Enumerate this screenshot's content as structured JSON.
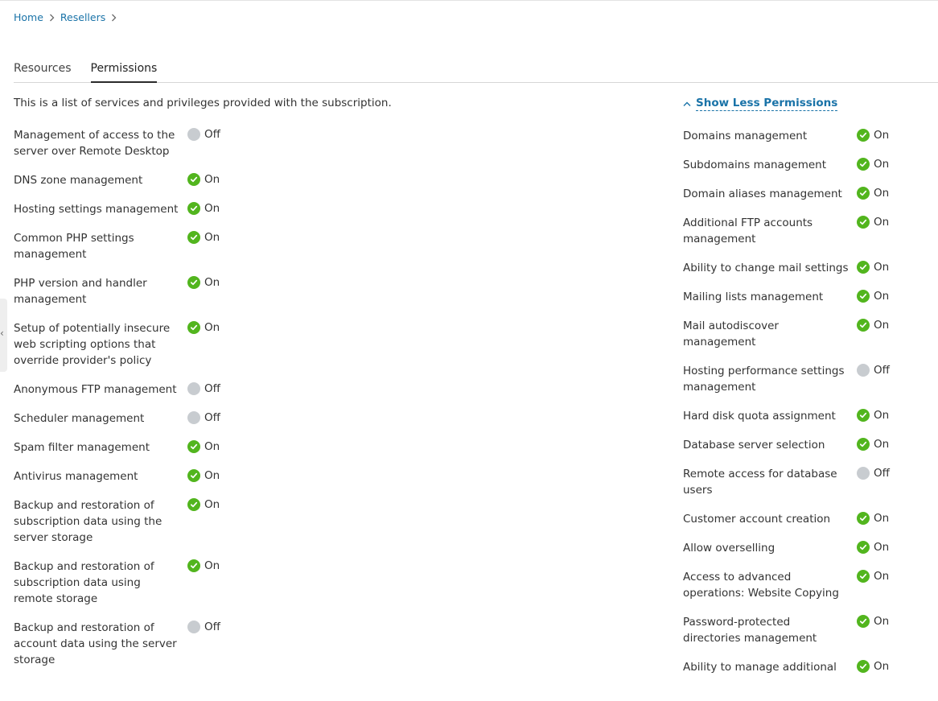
{
  "breadcrumb": {
    "home": "Home",
    "resellers": "Resellers"
  },
  "tabs": [
    {
      "label": "Resources",
      "active": false
    },
    {
      "label": "Permissions",
      "active": true
    }
  ],
  "intro": "This is a list of services and privileges provided with the subscription.",
  "show_less_label": "Show Less Permissions",
  "status_labels": {
    "on": "On",
    "off": "Off"
  },
  "colors": {
    "link": "#1a73a8",
    "on": "#52b51e",
    "off": "#c8ccd0"
  },
  "left_permissions": [
    {
      "label": "Management of access to the server over Remote Desktop",
      "status": "Off"
    },
    {
      "label": "DNS zone management",
      "status": "On"
    },
    {
      "label": "Hosting settings management",
      "status": "On"
    },
    {
      "label": "Common PHP settings management",
      "status": "On"
    },
    {
      "label": "PHP version and handler management",
      "status": "On"
    },
    {
      "label": "Setup of potentially insecure web scripting options that override provider's policy",
      "status": "On"
    },
    {
      "label": "Anonymous FTP management",
      "status": "Off"
    },
    {
      "label": "Scheduler management",
      "status": "Off"
    },
    {
      "label": "Spam filter management",
      "status": "On"
    },
    {
      "label": "Antivirus management",
      "status": "On"
    },
    {
      "label": "Backup and restoration of subscription data using the server storage",
      "status": "On"
    },
    {
      "label": "Backup and restoration of subscription data using remote storage",
      "status": "On"
    },
    {
      "label": "Backup and restoration of account data using the server storage",
      "status": "Off"
    }
  ],
  "right_permissions": [
    {
      "label": "Domains management",
      "status": "On"
    },
    {
      "label": "Subdomains management",
      "status": "On"
    },
    {
      "label": "Domain aliases management",
      "status": "On"
    },
    {
      "label": "Additional FTP accounts management",
      "status": "On"
    },
    {
      "label": "Ability to change mail settings",
      "status": "On"
    },
    {
      "label": "Mailing lists management",
      "status": "On"
    },
    {
      "label": "Mail autodiscover management",
      "status": "On"
    },
    {
      "label": "Hosting performance settings management",
      "status": "Off"
    },
    {
      "label": "Hard disk quota assignment",
      "status": "On"
    },
    {
      "label": "Database server selection",
      "status": "On"
    },
    {
      "label": "Remote access for database users",
      "status": "Off"
    },
    {
      "label": "Customer account creation",
      "status": "On"
    },
    {
      "label": "Allow overselling",
      "status": "On"
    },
    {
      "label": "Access to advanced operations: Website Copying",
      "status": "On"
    },
    {
      "label": "Password-protected directories management",
      "status": "On"
    },
    {
      "label": "Ability to manage additional",
      "status": "On"
    }
  ]
}
